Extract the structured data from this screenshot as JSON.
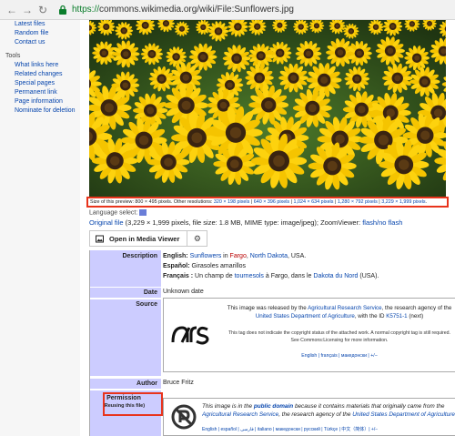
{
  "browser": {
    "url_scheme": "https://",
    "url_rest": "commons.wikimedia.org/wiki/File:Sunflowers.jpg"
  },
  "sidebar": {
    "top_links": [
      "Latest files",
      "Random file",
      "Contact us"
    ],
    "tools_heading": "Tools",
    "tool_links": [
      "What links here",
      "Related changes",
      "Special pages",
      "Permanent link",
      "Page information",
      "Nominate for deletion"
    ]
  },
  "preview": {
    "size_text": "Size of this preview: 800 × 495 pixels. Other resolutions: ",
    "resolutions": [
      "320 × 198 pixels",
      "640 × 396 pixels",
      "1,024 × 634 pixels",
      "1,280 × 792 pixels",
      "3,229 × 1,999 pixels"
    ]
  },
  "language_select": "Language select:",
  "original": {
    "link": "Original file",
    "text": " (3,229 × 1,999 pixels, file size: 1.8 MB, MIME type: image/jpeg); ZoomViewer: ",
    "zoom_link": "flash/no flash"
  },
  "toolbar": {
    "media_viewer_label": "Open in Media Viewer"
  },
  "info": {
    "description_label": "Description",
    "desc_en_prefix": "English: ",
    "desc_en_link1": "Sunflowers",
    "desc_en_mid": " in ",
    "desc_en_link2": "Fargo",
    "desc_en_comma": ", ",
    "desc_en_link3": "North Dakota",
    "desc_en_end": ", USA.",
    "desc_es_prefix": "Español: ",
    "desc_es_text": "Girasoles amarillos",
    "desc_fr_prefix": "Français : ",
    "desc_fr_text1": "Un champ de ",
    "desc_fr_link1": "tournesols",
    "desc_fr_text2": " à Fargo, dans le ",
    "desc_fr_link2": "Dakota du Nord",
    "desc_fr_end": " (USA).",
    "date_label": "Date",
    "date_value": "Unknown date",
    "source_label": "Source",
    "source_text1": "This image was released by the ",
    "source_link1": "Agricultural Research Service",
    "source_text2": ", the research agency of the",
    "source_link2": "United States Department of Agriculture",
    "source_text3": ", with the ID ",
    "source_link3": "K5751-1",
    "source_next": " (next) ",
    "source_small": "This tag does not indicate the copyright status of the attached work. A normal copyright tag is still required. See Commons:Licensing for more information.",
    "source_langs": "English | français | македонски | +/−",
    "author_label": "Author",
    "author_value": "Bruce Fritz",
    "permission_label": "Permission",
    "permission_sub": "(Reusing this file)",
    "pd_text1": "This image is in the ",
    "pd_link1": "public domain",
    "pd_text2": " because it contains materials that originally came from the ",
    "pd_link2": "Agricultural Research Service",
    "pd_text3": ", the research agency of the ",
    "pd_link3": "United States Department of Agriculture",
    "pd_end": ".",
    "pd_langs": "English | español | فارسی | italiano | македонски | русский | Türkçe | 中文（简体）| +/−"
  },
  "colors": {
    "highlight": "#e8341c",
    "label_bg": "#ccccff",
    "link": "#0645ad"
  }
}
